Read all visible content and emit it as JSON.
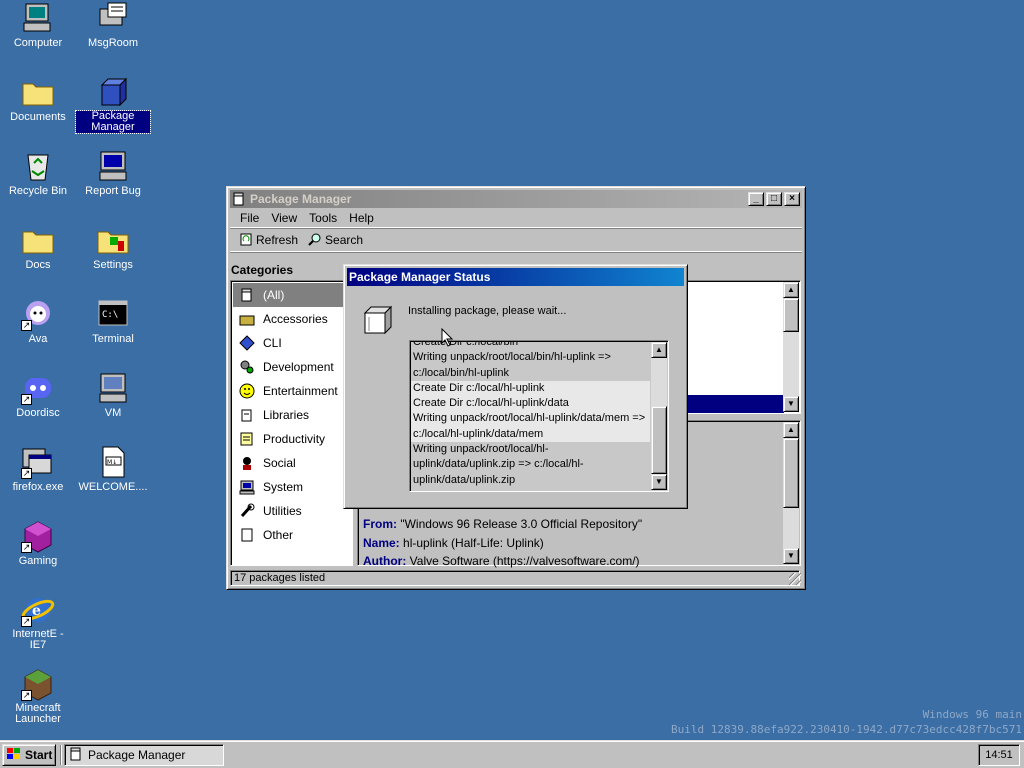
{
  "desktop": {
    "icons": [
      {
        "label": "Computer",
        "icon": "computer-icon"
      },
      {
        "label": "MsgRoom",
        "icon": "msgroom-icon"
      },
      {
        "label": "Documents",
        "icon": "folder-icon"
      },
      {
        "label": "Package Manager",
        "icon": "package-manager-icon"
      },
      {
        "label": "Recycle Bin",
        "icon": "recycle-bin-icon"
      },
      {
        "label": "Report Bug",
        "icon": "report-bug-icon"
      },
      {
        "label": "Docs",
        "icon": "folder-icon"
      },
      {
        "label": "Settings",
        "icon": "settings-icon"
      },
      {
        "label": "Ava",
        "icon": "ava-icon"
      },
      {
        "label": "Terminal",
        "icon": "terminal-icon"
      },
      {
        "label": "Doordisc",
        "icon": "doordisc-icon"
      },
      {
        "label": "VM",
        "icon": "vm-icon"
      },
      {
        "label": "firefox.exe",
        "icon": "firefox-icon"
      },
      {
        "label": "WELCOME....",
        "icon": "markdown-file-icon"
      },
      {
        "label": "Gaming",
        "icon": "gaming-icon"
      },
      {
        "label": "InternetE - IE7",
        "icon": "internet-explorer-icon"
      },
      {
        "label": "Minecraft Launcher",
        "icon": "minecraft-icon"
      }
    ],
    "watermark_line1": "Windows 96 main",
    "watermark_line2": "Build 12839.88efa922.230410-1942.d77c73edcc428f7bc571"
  },
  "pkg_window": {
    "title": "Package Manager",
    "menu": [
      "File",
      "View",
      "Tools",
      "Help"
    ],
    "toolbar": {
      "refresh": "Refresh",
      "search": "Search"
    },
    "categories_header": "Categories",
    "categories": [
      "(All)",
      "Accessories",
      "CLI",
      "Development",
      "Entertainment",
      "Libraries",
      "Productivity",
      "Social",
      "System",
      "Utilities",
      "Other"
    ],
    "selected_category": "(All)",
    "details": {
      "from_label": "From:",
      "from_value": "\"Windows 96 Release 3.0 Official Repository\"",
      "name_label": "Name:",
      "name_value": "hl-uplink (Half-Life: Uplink)",
      "author_label": "Author:",
      "author_value": "Valve Software (https://valvesoftware.com/)"
    },
    "status_bar": "17 packages listed"
  },
  "status_dialog": {
    "title": "Package Manager Status",
    "message": "Installing package, please wait...",
    "log": [
      "Create Dir c:/local/bin",
      "Writing unpack/root/local/bin/hl-uplink =>",
      "c:/local/bin/hl-uplink",
      "Create Dir c:/local/hl-uplink",
      "Create Dir c:/local/hl-uplink/data",
      "Writing unpack/root/local/hl-uplink/data/mem =>",
      "c:/local/hl-uplink/data/mem",
      "Writing unpack/root/local/hl-",
      "uplink/data/uplink.zip => c:/local/hl-",
      "uplink/data/uplink.zip"
    ]
  },
  "taskbar": {
    "start_label": "Start",
    "task_label": "Package Manager",
    "clock": "14:51"
  },
  "colors": {
    "desktop": "#3a6ea5",
    "title_active": "#000080",
    "window_face": "#c0c0c0"
  }
}
